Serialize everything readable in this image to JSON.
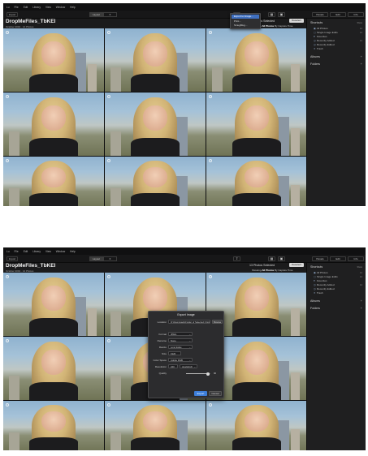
{
  "menu": [
    "Lu",
    "File",
    "Edit",
    "Library",
    "View",
    "Window",
    "Help"
  ],
  "toolbar": {
    "import_label": "Import",
    "view_modes": [
      "Layout",
      "≡",
      "⊡"
    ],
    "panels": [
      "Panels",
      "Edit",
      "Info"
    ]
  },
  "header": {
    "title": "DropMeFiles_TbKEI",
    "date": "October 2019 · 14 Photos",
    "selection_text": "13 Photos Selected",
    "deselect_label": "Deselect",
    "filter_label": "Showing",
    "filter_value": "All Photos",
    "sort_text": "By Capture Time"
  },
  "photos": [
    {
      "name": "photo-01"
    },
    {
      "name": "photo-02"
    },
    {
      "name": "photo-03"
    },
    {
      "name": "photo-04"
    },
    {
      "name": "photo-05"
    },
    {
      "name": "photo-06"
    },
    {
      "name": "photo-07"
    },
    {
      "name": "photo-08"
    },
    {
      "name": "photo-09"
    }
  ],
  "sidebar": {
    "shortcuts_title": "Shortcuts",
    "show_label": "Show",
    "items": [
      {
        "label": "All Photos",
        "icon": "▣",
        "count": "14"
      },
      {
        "label": "Single Image Edits",
        "icon": "▢",
        "count": "14"
      },
      {
        "label": "Favorites",
        "icon": "♥",
        "count": ""
      },
      {
        "label": "Recently Added",
        "icon": "◷",
        "count": "14"
      },
      {
        "label": "Recently Edited",
        "icon": "◷",
        "count": ""
      },
      {
        "label": "Trash",
        "icon": "✕",
        "count": ""
      }
    ],
    "albums_title": "Albums",
    "folders_title": "Folders"
  },
  "export_menu": {
    "items": [
      "Export to Image…",
      "Print…",
      "SmugMug…"
    ]
  },
  "export_dialog": {
    "title": "Export Image",
    "location_label": "Location",
    "location_value": "D:\\Downloads\\Folder of Selected Originals",
    "browse_label": "Browse",
    "format_label": "Format",
    "format_value": "JPEG",
    "rename_label": "Rename",
    "rename_value": "None",
    "resize_label": "Resize",
    "resize_value": "Long Edge",
    "size_label": "Size",
    "size_value": "1920",
    "colorspace_label": "Color Space",
    "colorspace_value": "Adobe RGB",
    "resolution_label": "Resolution",
    "resolution_value": "240",
    "resolution_unit": "pixels/inch",
    "quality_label": "Quality",
    "quality_value": "90",
    "quality_fraction": 0.9,
    "export_label": "Export",
    "cancel_label": "Cancel"
  },
  "colors": {
    "app_bg": "#1b1b1c",
    "accent": "#3d7ed8"
  }
}
